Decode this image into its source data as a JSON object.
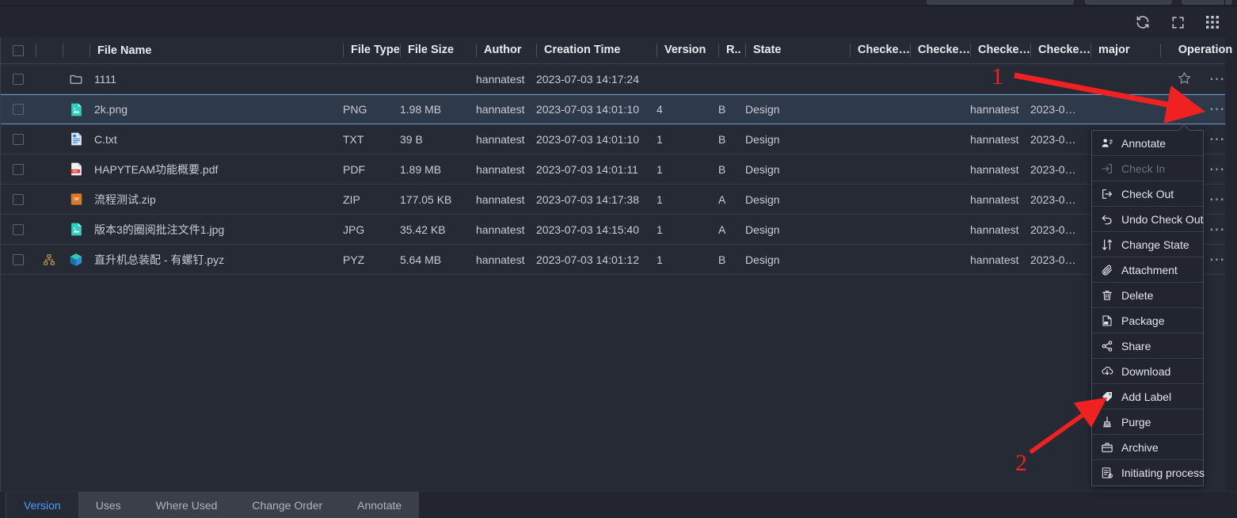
{
  "toolbar": {
    "buttons": [
      {
        "name": "refresh-icon",
        "label": "Refresh"
      },
      {
        "name": "fullscreen-icon",
        "label": "Fullscreen"
      },
      {
        "name": "apps-grid-icon",
        "label": "Apps"
      }
    ]
  },
  "table": {
    "columns": {
      "file_name": "File Name",
      "file_type": "File Type",
      "file_size": "File Size",
      "author": "Author",
      "creation_time": "Creation Time",
      "version": "Version",
      "r": "R..",
      "state": "State",
      "checked1": "Checke…",
      "checked2": "Checke…",
      "checked3": "Checke…",
      "checked4": "Checke…",
      "major": "major",
      "operation": "Operation"
    },
    "rows": [
      {
        "icon": "folder-icon",
        "name": "1111",
        "type": "",
        "size": "",
        "author": "hannatest",
        "creation_time": "2023-07-03 14:17:24",
        "version": "",
        "r": "",
        "state": "",
        "checked3": "",
        "checked4": "",
        "selected": false,
        "has_tree": false
      },
      {
        "icon": "image-file-icon",
        "name": "2k.png",
        "type": "PNG",
        "size": "1.98 MB",
        "author": "hannatest",
        "creation_time": "2023-07-03 14:01:10",
        "version": "4",
        "r": "B",
        "state": "Design",
        "checked3": "hannatest",
        "checked4": "2023-0…",
        "selected": true,
        "has_tree": false
      },
      {
        "icon": "txt-file-icon",
        "name": "C.txt",
        "type": "TXT",
        "size": "39 B",
        "author": "hannatest",
        "creation_time": "2023-07-03 14:01:10",
        "version": "1",
        "r": "B",
        "state": "Design",
        "checked3": "hannatest",
        "checked4": "2023-0…",
        "selected": false,
        "has_tree": false
      },
      {
        "icon": "pdf-file-icon",
        "name": "HAPYTEAM功能概要.pdf",
        "type": "PDF",
        "size": "1.89 MB",
        "author": "hannatest",
        "creation_time": "2023-07-03 14:01:11",
        "version": "1",
        "r": "B",
        "state": "Design",
        "checked3": "hannatest",
        "checked4": "2023-0…",
        "selected": false,
        "has_tree": false
      },
      {
        "icon": "zip-file-icon",
        "name": "流程测试.zip",
        "type": "ZIP",
        "size": "177.05 KB",
        "author": "hannatest",
        "creation_time": "2023-07-03 14:17:38",
        "version": "1",
        "r": "A",
        "state": "Design",
        "checked3": "hannatest",
        "checked4": "2023-0…",
        "selected": false,
        "has_tree": false
      },
      {
        "icon": "image-file-icon",
        "name": "版本3的圈阅批注文件1.jpg",
        "type": "JPG",
        "size": "35.42 KB",
        "author": "hannatest",
        "creation_time": "2023-07-03 14:15:40",
        "version": "1",
        "r": "A",
        "state": "Design",
        "checked3": "hannatest",
        "checked4": "2023-0…",
        "selected": false,
        "has_tree": false
      },
      {
        "icon": "cad-model-icon",
        "name": "直升机总装配 - 有螺钉.pyz",
        "type": "PYZ",
        "size": "5.64 MB",
        "author": "hannatest",
        "creation_time": "2023-07-03 14:01:12",
        "version": "1",
        "r": "B",
        "state": "Design",
        "checked3": "hannatest",
        "checked4": "2023-0…",
        "selected": false,
        "has_tree": true
      }
    ]
  },
  "context_menu": {
    "items": [
      {
        "label": "Annotate",
        "icon": "annotate-icon",
        "disabled": false
      },
      {
        "label": "Check In",
        "icon": "check-in-icon",
        "disabled": true
      },
      {
        "label": "Check Out",
        "icon": "check-out-icon",
        "disabled": false
      },
      {
        "label": "Undo Check Out",
        "icon": "undo-check-out-icon",
        "disabled": false
      },
      {
        "label": "Change State",
        "icon": "change-state-icon",
        "disabled": false
      },
      {
        "label": "Attachment",
        "icon": "paperclip-icon",
        "disabled": false
      },
      {
        "label": "Delete",
        "icon": "trash-icon",
        "disabled": false
      },
      {
        "label": "Package",
        "icon": "package-icon",
        "disabled": false
      },
      {
        "label": "Share",
        "icon": "share-icon",
        "disabled": false
      },
      {
        "label": "Download",
        "icon": "download-cloud-icon",
        "disabled": false
      },
      {
        "label": "Add Label",
        "icon": "label-tag-icon",
        "disabled": false
      },
      {
        "label": "Purge",
        "icon": "purge-broom-icon",
        "disabled": false
      },
      {
        "label": "Archive",
        "icon": "archive-box-icon",
        "disabled": false
      },
      {
        "label": "Initiating process",
        "icon": "initiate-process-icon",
        "disabled": false
      }
    ]
  },
  "annotations": {
    "color": "#ef2121",
    "markers": [
      {
        "label": "1",
        "points_to": "row-more-options-button"
      },
      {
        "label": "2",
        "points_to": "menu-item-add-label"
      }
    ]
  },
  "bottom_tabs": {
    "items": [
      {
        "label": "Version",
        "active": true
      },
      {
        "label": "Uses",
        "active": false
      },
      {
        "label": "Where Used",
        "active": false
      },
      {
        "label": "Change Order",
        "active": false
      },
      {
        "label": "Annotate",
        "active": false
      }
    ]
  }
}
